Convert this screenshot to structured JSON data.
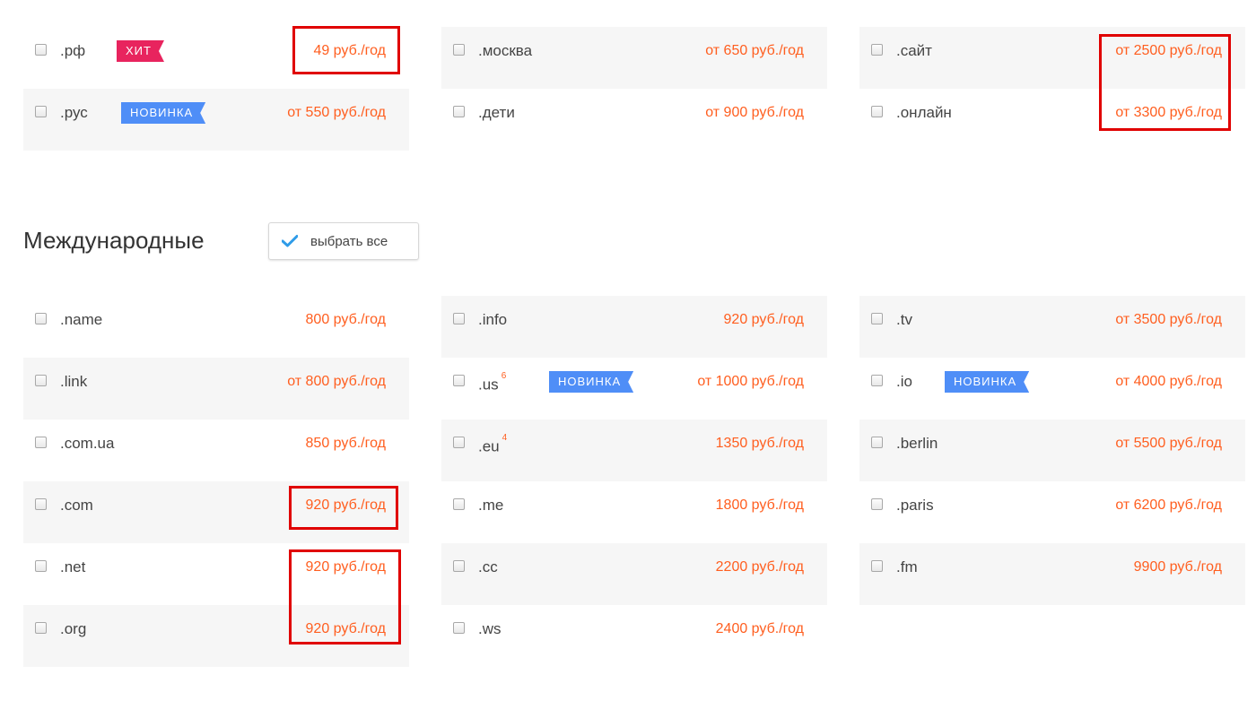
{
  "top_zones": {
    "columns": [
      [
        {
          "zone": ".рф",
          "price": "49 руб./год",
          "tag": "ХИТ",
          "tag_type": "hit",
          "shaded": false
        },
        {
          "zone": ".рус",
          "price": "от 550 руб./год",
          "tag": "НОВИНКА",
          "tag_type": "new",
          "shaded": true
        }
      ],
      [
        {
          "zone": ".москва",
          "price": "от 650 руб./год",
          "shaded": true
        },
        {
          "zone": ".дети",
          "price": "от 900 руб./год",
          "shaded": false
        }
      ],
      [
        {
          "zone": ".сайт",
          "price": "от 2500 руб./год",
          "shaded": true
        },
        {
          "zone": ".онлайн",
          "price": "от 3300 руб./год",
          "shaded": false
        }
      ]
    ]
  },
  "international": {
    "title": "Международные",
    "select_all_label": "выбрать все",
    "columns": [
      [
        {
          "zone": ".name",
          "price": "800 руб./год",
          "shaded": false
        },
        {
          "zone": ".link",
          "price": "от 800 руб./год",
          "shaded": true
        },
        {
          "zone": ".com.ua",
          "price": "850 руб./год",
          "shaded": false
        },
        {
          "zone": ".com",
          "price": "920 руб./год",
          "shaded": true
        },
        {
          "zone": ".net",
          "price": "920 руб./год",
          "shaded": false
        },
        {
          "zone": ".org",
          "price": "920 руб./год",
          "shaded": true
        }
      ],
      [
        {
          "zone": ".info",
          "price": "920 руб./год",
          "shaded": true
        },
        {
          "zone": ".us",
          "sup": "6",
          "price": "от 1000 руб./год",
          "tag": "НОВИНКА",
          "tag_type": "new",
          "shaded": false
        },
        {
          "zone": ".eu",
          "sup": "4",
          "price": "1350 руб./год",
          "shaded": true
        },
        {
          "zone": ".me",
          "price": "1800 руб./год",
          "shaded": false
        },
        {
          "zone": ".cc",
          "price": "2200 руб./год",
          "shaded": true
        },
        {
          "zone": ".ws",
          "price": "2400 руб./год",
          "shaded": false
        }
      ],
      [
        {
          "zone": ".tv",
          "price": "от 3500 руб./год",
          "shaded": true
        },
        {
          "zone": ".io",
          "price": "от 4000 руб./год",
          "tag": "НОВИНКА",
          "tag_type": "new",
          "shaded": false
        },
        {
          "zone": ".berlin",
          "price": "от 5500 руб./год",
          "shaded": true
        },
        {
          "zone": ".paris",
          "price": "от 6200 руб./год",
          "shaded": false
        },
        {
          "zone": ".fm",
          "price": "9900 руб./год",
          "shaded": true
        }
      ]
    ]
  },
  "colors": {
    "price": "#ff5e1f",
    "hit_tag": "#e8245e",
    "new_tag": "#4f8ef7",
    "highlight": "#e00000",
    "check_icon": "#2f9ce8"
  }
}
